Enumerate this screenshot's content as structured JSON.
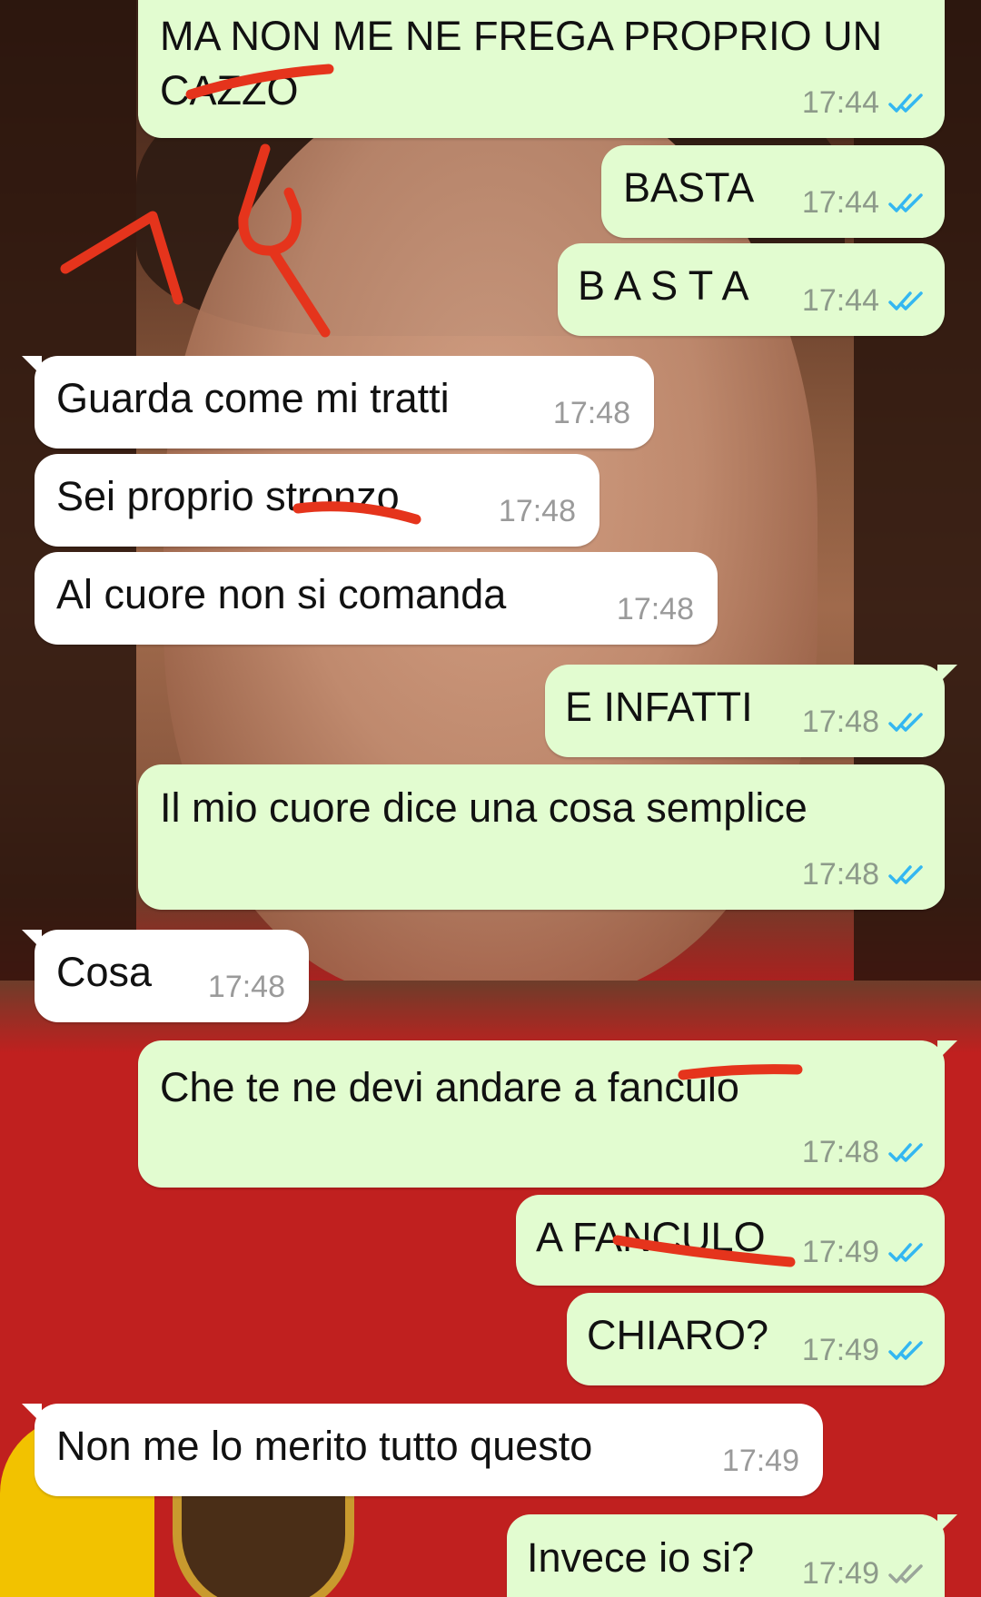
{
  "messages": [
    {
      "dir": "out",
      "text": "MA NON ME NE FREGA PROPRIO UN CAZZO",
      "line1": "MA NON ME NE FREGA PROPRIO UN",
      "line2": "CAZZO",
      "time": "17:44"
    },
    {
      "dir": "out",
      "text": "BASTA",
      "time": "17:44"
    },
    {
      "dir": "out",
      "text": "B A S T A",
      "time": "17:44"
    },
    {
      "dir": "in",
      "text": "Guarda come mi tratti",
      "time": "17:48"
    },
    {
      "dir": "in",
      "text": "Sei proprio stronzo",
      "time": "17:48"
    },
    {
      "dir": "in",
      "text": "Al cuore non si comanda",
      "time": "17:48"
    },
    {
      "dir": "out",
      "text": "E INFATTI",
      "time": "17:48"
    },
    {
      "dir": "out",
      "text": "Il mio cuore dice una cosa semplice",
      "time": "17:48"
    },
    {
      "dir": "in",
      "text": "Cosa",
      "time": "17:48"
    },
    {
      "dir": "out",
      "text": "Che te ne devi andare a fanculo",
      "time": "17:48"
    },
    {
      "dir": "out",
      "text": "A FANCULO",
      "time": "17:49"
    },
    {
      "dir": "out",
      "text": "CHIARO?",
      "time": "17:49"
    },
    {
      "dir": "in",
      "text": "Non me lo merito tutto questo",
      "time": "17:49"
    },
    {
      "dir": "out",
      "text": "Invece io si?",
      "time": "17:49"
    }
  ],
  "annotation": {
    "text": "14",
    "color": "#e5341c"
  },
  "colors": {
    "outgoing_bubble": "#e2fcd0",
    "incoming_bubble": "#ffffff",
    "read_ticks": "#34b7f1",
    "censor_mark": "#e5341c"
  },
  "icons": {
    "read_receipt": "double-check-icon"
  }
}
